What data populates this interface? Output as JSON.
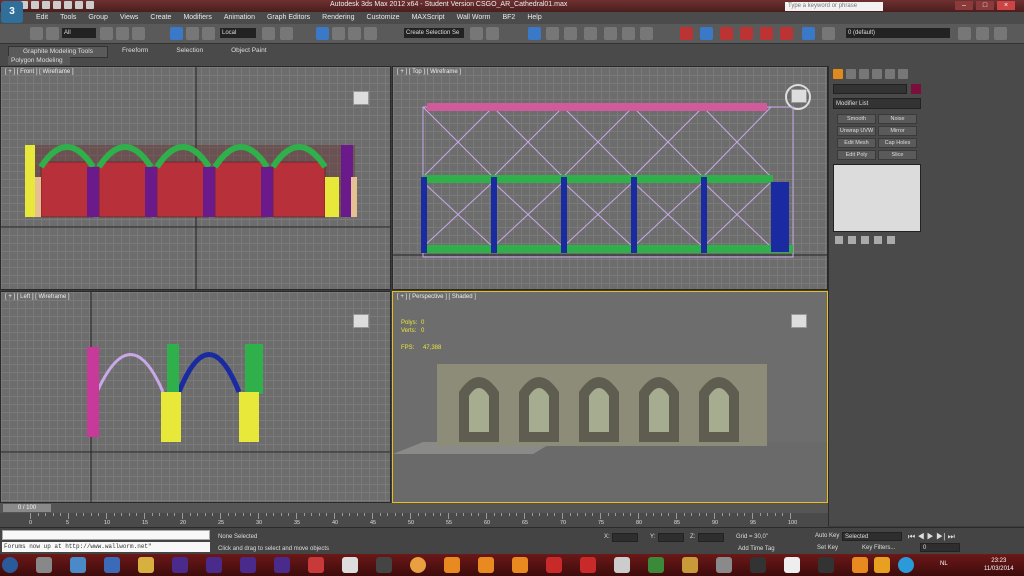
{
  "titlebar": {
    "title": "Autodesk 3ds Max  2012 x64  -  Student Version    CSGO_AR_Cathedral01.max",
    "search_placeholder": "Type a keyword or phrase"
  },
  "menu": [
    "Edit",
    "Tools",
    "Group",
    "Views",
    "Create",
    "Modifiers",
    "Animation",
    "Graph Editors",
    "Rendering",
    "Customize",
    "MAXScript",
    "Wall Worm",
    "BF2",
    "Help"
  ],
  "toolbar": {
    "filter": "All",
    "coord": "Local",
    "selection_set": "Create Selection Se",
    "layer": "0 (default)"
  },
  "ribbon": {
    "tabs": [
      "Graphite Modeling Tools",
      "Freeform",
      "Selection",
      "Object Paint"
    ],
    "subtab": "Polygon Modeling"
  },
  "viewports": {
    "front": "[ + ] [ Front ] [ Wireframe ]",
    "top": "[ + ] [ Top ] [ Wireframe ]",
    "left": "[ + ] [ Left ] [ Wireframe ]",
    "perspective": "[ + ] [ Perspective ] [ Shaded ]",
    "polys_label": "Polys:",
    "polys_value": "0",
    "verts_label": "Verts:",
    "verts_value": "0",
    "fps_label": "FPS:",
    "fps_value": "47,388"
  },
  "command_panel": {
    "modifier_list": "Modifier List",
    "buttons": [
      "Smooth",
      "Noise",
      "Unwrap UVW",
      "Mirror",
      "Edit Mesh",
      "Cap Holes",
      "Edit Poly",
      "Slice"
    ],
    "object_color": "#7a0f3c"
  },
  "timeline": {
    "slider": "0 / 100",
    "ticks": [
      "0",
      "5",
      "10",
      "15",
      "20",
      "25",
      "30",
      "35",
      "40",
      "45",
      "50",
      "55",
      "60",
      "65",
      "70",
      "75",
      "80",
      "85",
      "90",
      "95",
      "100"
    ]
  },
  "status": {
    "maxscript": "Forums now up at http://www.wallworm.net\"",
    "selection": "None Selected",
    "prompt": "Click and drag to select and move objects",
    "x": "X:",
    "y": "Y:",
    "z": "Z:",
    "grid": "Grid = 30,0\"",
    "add_time_tag": "Add Time Tag",
    "auto_key": "Auto Key",
    "auto_key_value": "Selected",
    "set_key": "Set Key",
    "key_filters": "Key Filters...",
    "frame": "0"
  },
  "taskbar": {
    "lang": "NL",
    "time": "23:23",
    "date": "11/03/2014"
  }
}
